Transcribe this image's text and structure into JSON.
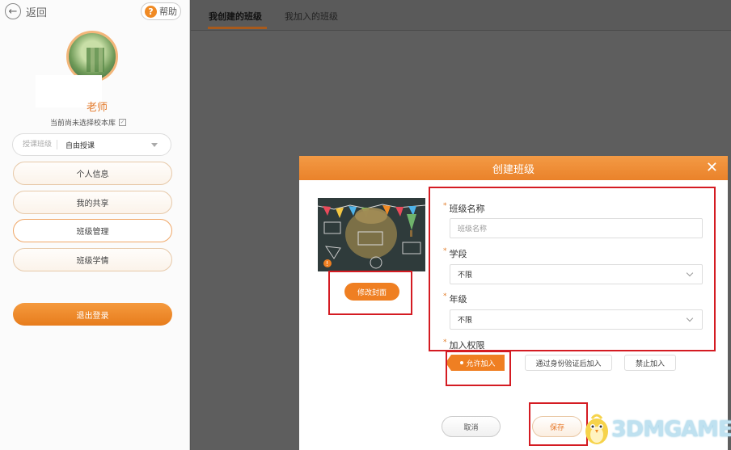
{
  "sidebar": {
    "back_label": "返回",
    "help_label": "帮助",
    "teacher_name": "老师",
    "school_note": "当前尚未选择校本库",
    "teaching_select": {
      "label": "授课班级",
      "value": "自由授课"
    },
    "menu": [
      {
        "label": "个人信息"
      },
      {
        "label": "我的共享"
      },
      {
        "label": "班级管理"
      },
      {
        "label": "班级学情"
      }
    ],
    "logout_label": "退出登录"
  },
  "tabs": [
    {
      "label": "我创建的班级"
    },
    {
      "label": "我加入的班级"
    }
  ],
  "modal": {
    "title": "创建班级",
    "close_glyph": "✕",
    "cover_button": "修改封面",
    "class_name": {
      "label": "班级名称",
      "placeholder": "班级名称"
    },
    "stage": {
      "label": "学段",
      "value": "不限"
    },
    "grade": {
      "label": "年级",
      "value": "不限"
    },
    "permission": {
      "label": "加入权限",
      "options": [
        {
          "label": "允许加入"
        },
        {
          "label": "通过身份验证后加入"
        },
        {
          "label": "禁止加入"
        }
      ]
    },
    "cancel_label": "取消",
    "save_label": "保存"
  },
  "watermark": {
    "text": "3DMGAME"
  },
  "colors": {
    "accent": "#ef7f22",
    "highlight_box": "#d41b22"
  }
}
